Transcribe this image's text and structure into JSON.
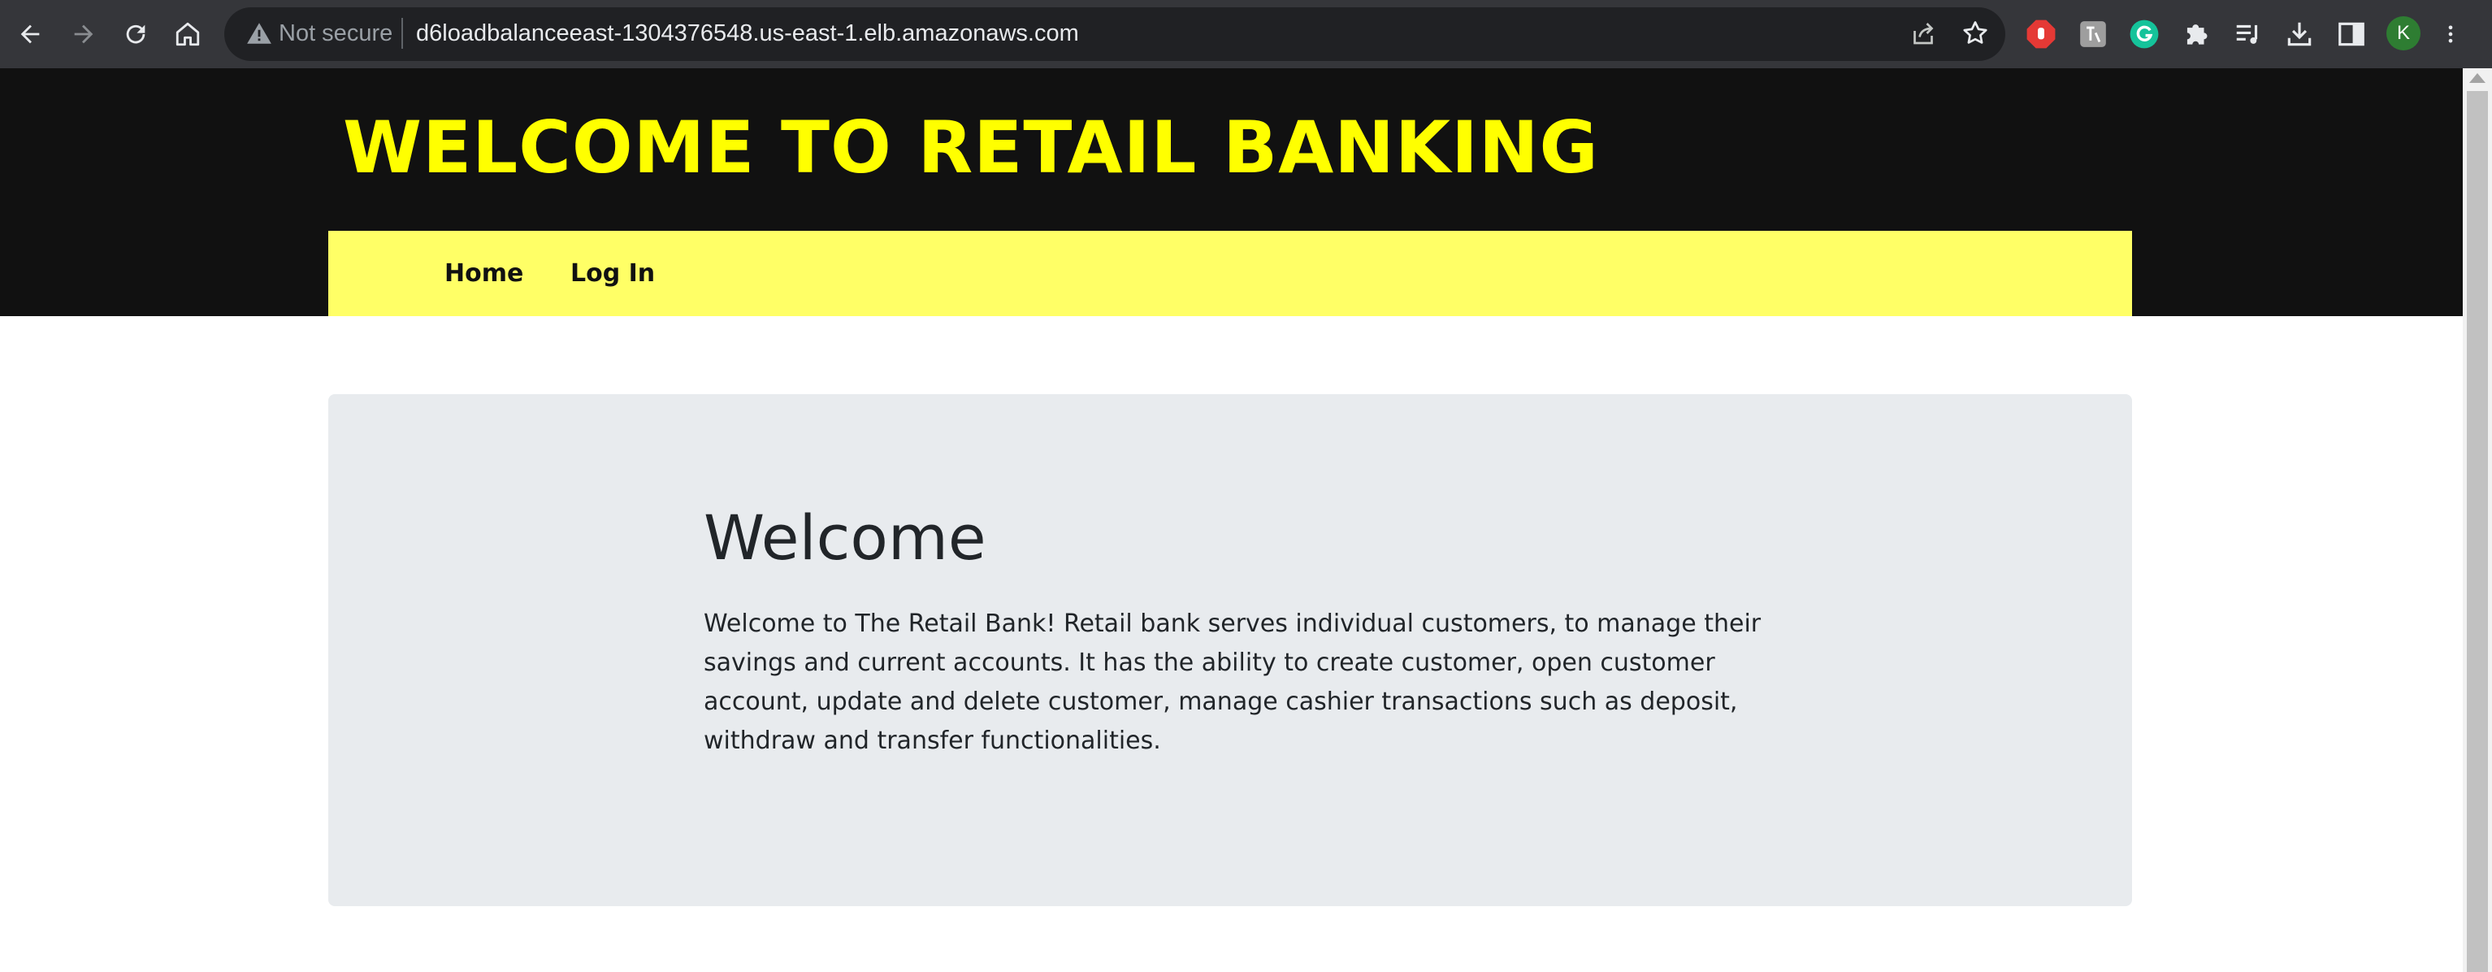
{
  "browser": {
    "security_label": "Not secure",
    "url": "d6loadbalanceeast-1304376548.us-east-1.elb.amazonaws.com",
    "profile_initial": "K",
    "colors": {
      "toolbar": "#35363a",
      "omnibox": "#202124",
      "profile": "#2e7d32"
    }
  },
  "site": {
    "title": "WELCOME TO RETAIL BANKING",
    "nav": [
      {
        "label": "Home"
      },
      {
        "label": "Log In"
      }
    ],
    "colors": {
      "header_bg": "#111111",
      "title": "#ffff00",
      "navbar_bg": "#ffff66",
      "panel_bg": "#e8ebee"
    }
  },
  "main": {
    "heading": "Welcome",
    "body": "Welcome to The Retail Bank! Retail bank serves individual customers, to manage their savings and current accounts. It has the ability to create customer, open customer account, update and delete customer, manage cashier transactions such as deposit, withdraw and transfer functionalities."
  }
}
